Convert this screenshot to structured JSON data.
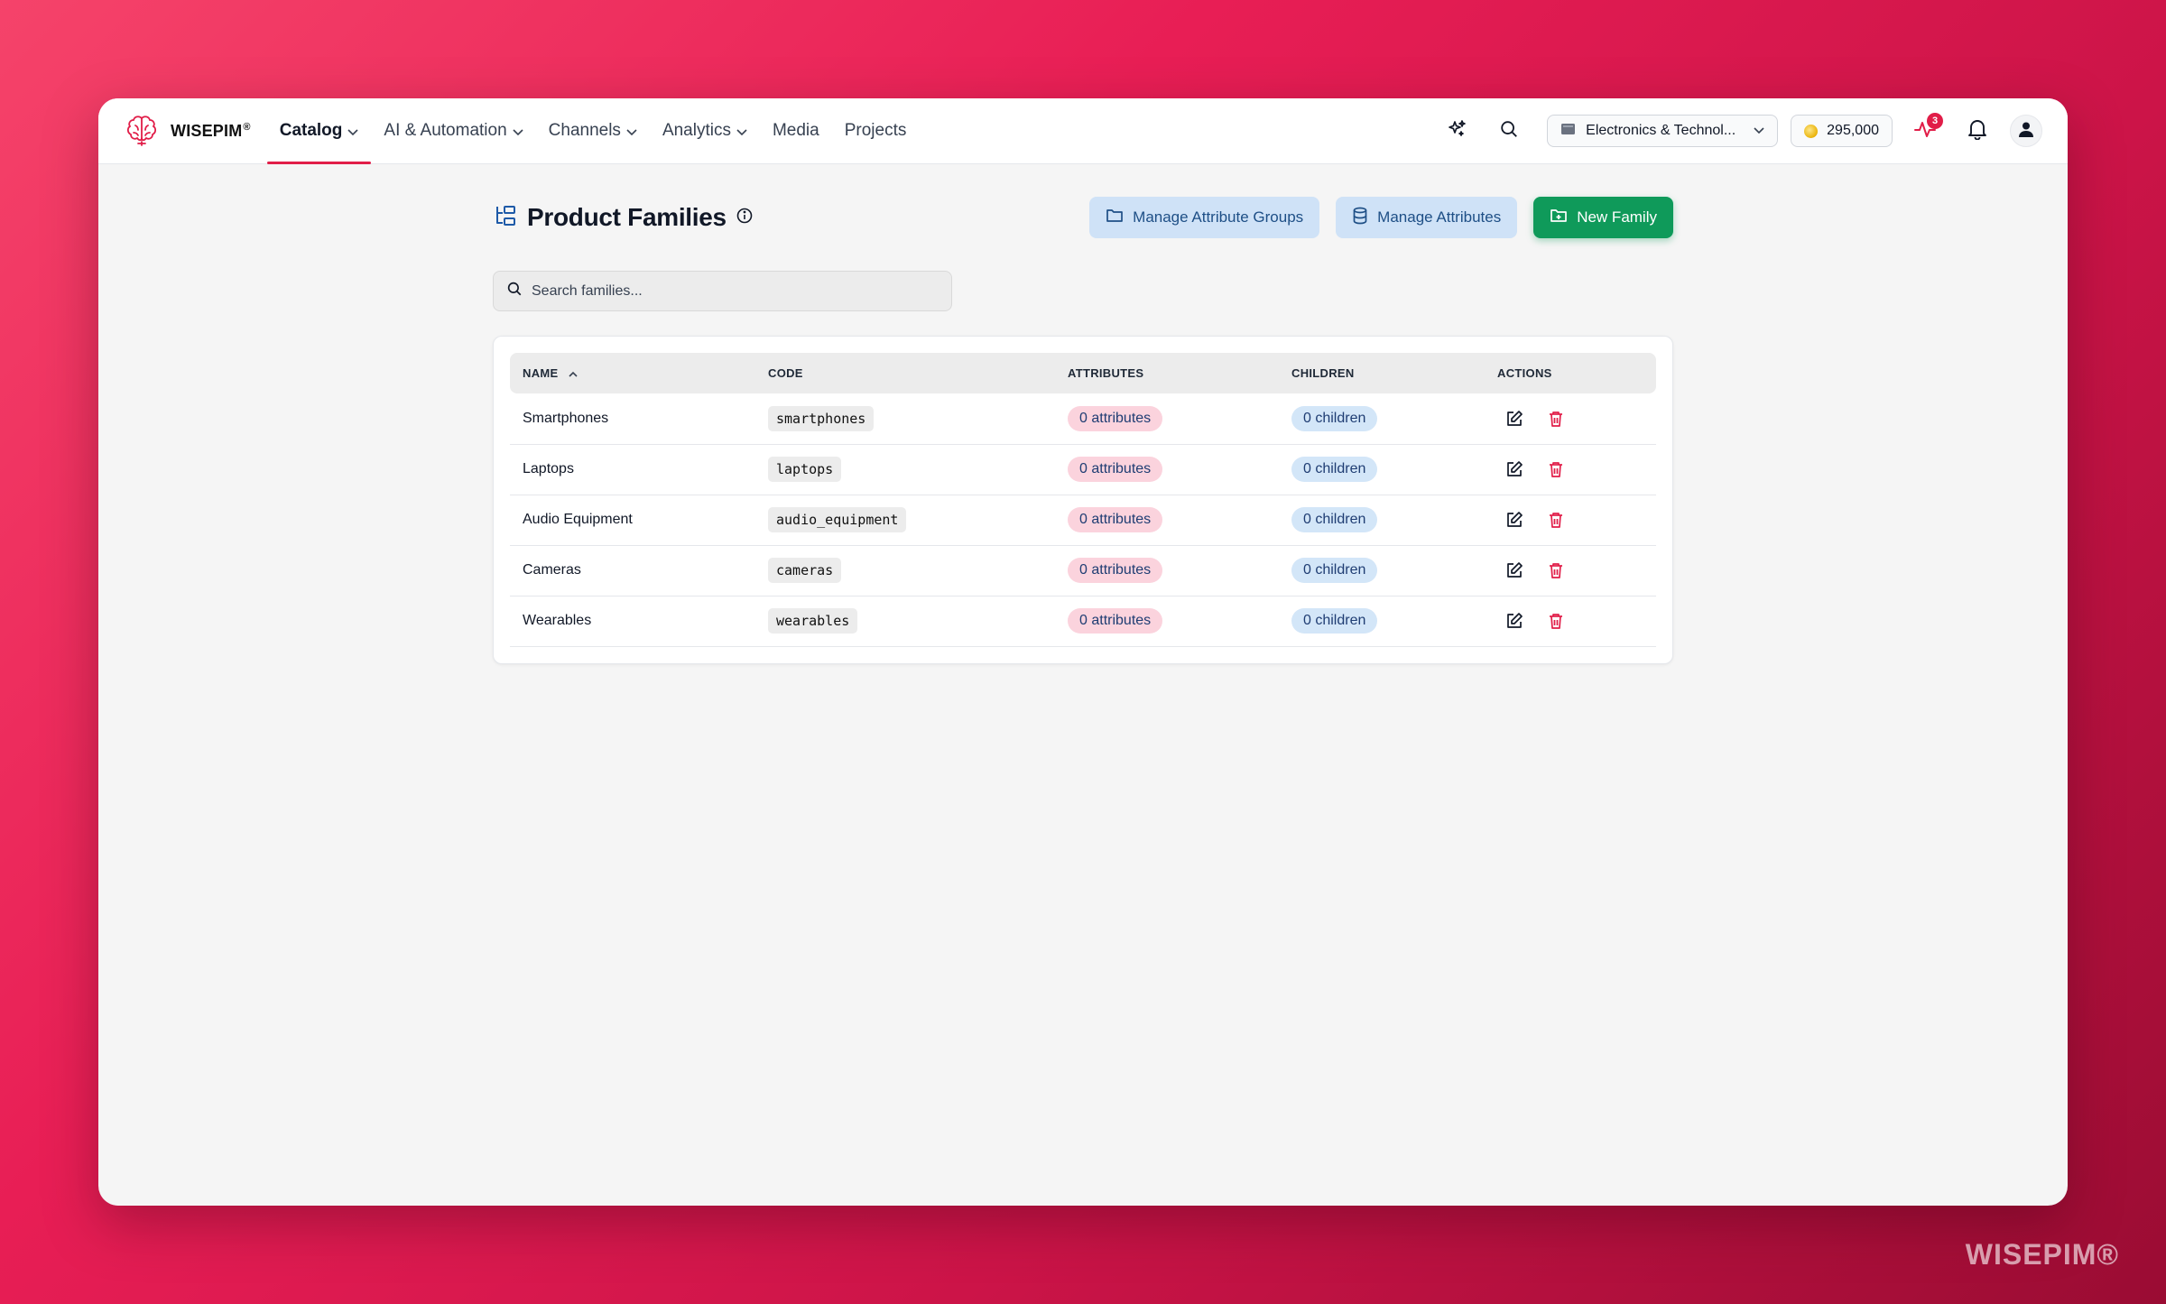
{
  "brand": {
    "name": "WISEPIM",
    "reg": "®"
  },
  "nav": {
    "items": [
      {
        "label": "Catalog",
        "dropdown": true,
        "active": true
      },
      {
        "label": "AI & Automation",
        "dropdown": true
      },
      {
        "label": "Channels",
        "dropdown": true
      },
      {
        "label": "Analytics",
        "dropdown": true
      },
      {
        "label": "Media",
        "dropdown": false
      },
      {
        "label": "Projects",
        "dropdown": false
      }
    ]
  },
  "topbar": {
    "catalog_selector": "Electronics & Technol...",
    "credits": "295,000",
    "activity_badge": "3",
    "icons": [
      "sparkles-icon",
      "search-icon",
      "catalog-icon",
      "coin-icon",
      "activity-icon",
      "bell-icon",
      "user-icon"
    ]
  },
  "page": {
    "title": "Product Families",
    "buttons": {
      "manage_groups": "Manage Attribute Groups",
      "manage_attributes": "Manage Attributes",
      "new_family": "New Family"
    },
    "search_placeholder": "Search families..."
  },
  "table": {
    "headers": {
      "name": "NAME",
      "code": "CODE",
      "attributes": "ATTRIBUTES",
      "children": "CHILDREN",
      "actions": "ACTIONS"
    },
    "sort": {
      "column": "NAME",
      "direction": "asc"
    },
    "rows": [
      {
        "name": "Smartphones",
        "code": "smartphones",
        "attributes": "0 attributes",
        "children": "0 children"
      },
      {
        "name": "Laptops",
        "code": "laptops",
        "attributes": "0 attributes",
        "children": "0 children"
      },
      {
        "name": "Audio Equipment",
        "code": "audio_equipment",
        "attributes": "0 attributes",
        "children": "0 children"
      },
      {
        "name": "Cameras",
        "code": "cameras",
        "attributes": "0 attributes",
        "children": "0 children"
      },
      {
        "name": "Wearables",
        "code": "wearables",
        "attributes": "0 attributes",
        "children": "0 children"
      }
    ]
  },
  "colors": {
    "accent": "#e11d48",
    "primary_button": "#0f9a5a",
    "soft_button": "#cfe2f7",
    "attr_pill": "#fbd3dd",
    "child_pill": "#d3e6f8"
  },
  "watermark": "WISEPIM®"
}
